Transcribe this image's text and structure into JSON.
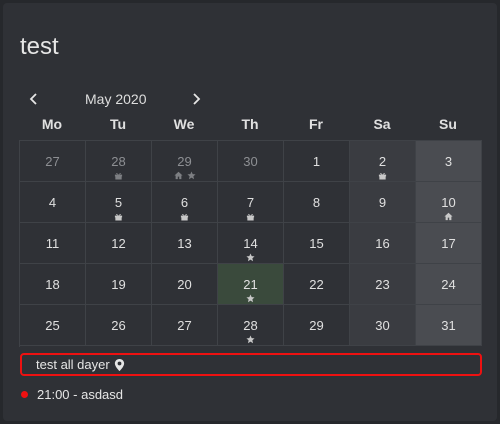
{
  "title": "test",
  "month_label": "May 2020",
  "weekdays": [
    "Mo",
    "Tu",
    "We",
    "Th",
    "Fr",
    "Sa",
    "Su"
  ],
  "days": [
    {
      "n": "27",
      "other": true,
      "marks": []
    },
    {
      "n": "28",
      "other": true,
      "marks": [
        "gift-icon"
      ]
    },
    {
      "n": "29",
      "other": true,
      "marks": [
        "home-icon",
        "star-icon"
      ]
    },
    {
      "n": "30",
      "other": true,
      "marks": []
    },
    {
      "n": "1",
      "marks": []
    },
    {
      "n": "2",
      "marks": [
        "gift-icon"
      ]
    },
    {
      "n": "3",
      "marks": []
    },
    {
      "n": "4",
      "marks": []
    },
    {
      "n": "5",
      "marks": [
        "gift-icon"
      ]
    },
    {
      "n": "6",
      "marks": [
        "gift-icon"
      ]
    },
    {
      "n": "7",
      "marks": [
        "gift-icon"
      ]
    },
    {
      "n": "8",
      "marks": []
    },
    {
      "n": "9",
      "marks": []
    },
    {
      "n": "10",
      "marks": [
        "home-icon"
      ]
    },
    {
      "n": "11",
      "marks": []
    },
    {
      "n": "12",
      "marks": []
    },
    {
      "n": "13",
      "marks": []
    },
    {
      "n": "14",
      "marks": [
        "star-icon"
      ]
    },
    {
      "n": "15",
      "marks": []
    },
    {
      "n": "16",
      "marks": []
    },
    {
      "n": "17",
      "marks": []
    },
    {
      "n": "18",
      "marks": []
    },
    {
      "n": "19",
      "marks": []
    },
    {
      "n": "20",
      "marks": []
    },
    {
      "n": "21",
      "today": true,
      "marks": [
        "star-icon"
      ]
    },
    {
      "n": "22",
      "marks": []
    },
    {
      "n": "23",
      "marks": []
    },
    {
      "n": "24",
      "marks": []
    },
    {
      "n": "25",
      "marks": []
    },
    {
      "n": "26",
      "marks": []
    },
    {
      "n": "27",
      "marks": []
    },
    {
      "n": "28",
      "marks": [
        "star-icon"
      ]
    },
    {
      "n": "29",
      "marks": []
    },
    {
      "n": "30",
      "marks": []
    },
    {
      "n": "31",
      "marks": []
    }
  ],
  "selected_event": {
    "label": "test all dayer",
    "icon": "map-pin-icon",
    "border_color": "#ee1111"
  },
  "events": [
    {
      "label": "21:00 - asdasd",
      "dot_color": "#ee1111"
    }
  ],
  "colors": {
    "background": "#2f3136",
    "weekend_sat": "#3a3c41",
    "weekend_sun": "#4a4c51",
    "today": "#3a4a3c"
  }
}
